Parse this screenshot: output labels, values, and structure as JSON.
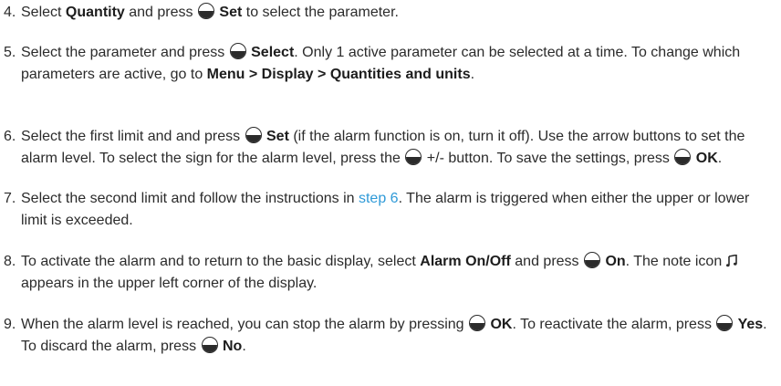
{
  "steps": [
    {
      "number": "4.",
      "parts": [
        {
          "t": "text",
          "v": "Select "
        },
        {
          "t": "bold",
          "v": "Quantity"
        },
        {
          "t": "text",
          "v": " and press "
        },
        {
          "t": "icon",
          "v": "softkey-button-icon"
        },
        {
          "t": "bold",
          "v": " Set"
        },
        {
          "t": "text",
          "v": " to select the parameter."
        }
      ]
    },
    {
      "number": "5.",
      "parts": [
        {
          "t": "text",
          "v": "Select the parameter and press "
        },
        {
          "t": "icon",
          "v": "softkey-button-icon"
        },
        {
          "t": "bold",
          "v": " Select"
        },
        {
          "t": "text",
          "v": ". Only 1 active parameter can be selected at a time. To change which parameters are active, go to "
        },
        {
          "t": "bold",
          "v": "Menu > Display > Quantities and units"
        },
        {
          "t": "text",
          "v": "."
        }
      ]
    },
    {
      "number": "6.",
      "parts": [
        {
          "t": "text",
          "v": "Select the first limit and and press "
        },
        {
          "t": "icon",
          "v": "softkey-button-icon"
        },
        {
          "t": "bold",
          "v": " Set"
        },
        {
          "t": "text",
          "v": " (if the alarm function is on, turn it off). Use the arrow buttons to set the alarm level. To select the sign for the alarm level, press the "
        },
        {
          "t": "icon",
          "v": "softkey-button-icon"
        },
        {
          "t": "text",
          "v": " +/- button. To save the settings, press "
        },
        {
          "t": "icon",
          "v": "softkey-button-icon"
        },
        {
          "t": "bold",
          "v": " OK"
        },
        {
          "t": "text",
          "v": "."
        }
      ]
    },
    {
      "number": "7.",
      "parts": [
        {
          "t": "text",
          "v": "Select the second limit and follow the instructions in "
        },
        {
          "t": "link",
          "v": "step 6"
        },
        {
          "t": "text",
          "v": ". The alarm is triggered when either the upper or lower limit is exceeded."
        }
      ]
    },
    {
      "number": "8.",
      "parts": [
        {
          "t": "text",
          "v": "To activate the alarm and to return to the basic display, select "
        },
        {
          "t": "bold",
          "v": "Alarm On/Off"
        },
        {
          "t": "text",
          "v": " and press "
        },
        {
          "t": "icon",
          "v": "softkey-button-icon"
        },
        {
          "t": "text",
          "v": " "
        },
        {
          "t": "bold",
          "v": "On"
        },
        {
          "t": "text",
          "v": ". The note icon "
        },
        {
          "t": "icon",
          "v": "music-note-icon"
        },
        {
          "t": "text",
          "v": " appears in the upper left corner of the display."
        }
      ]
    },
    {
      "number": "9.",
      "parts": [
        {
          "t": "text",
          "v": "When the alarm level is reached, you can stop the alarm by pressing "
        },
        {
          "t": "icon",
          "v": "softkey-button-icon"
        },
        {
          "t": "bold",
          "v": " OK"
        },
        {
          "t": "text",
          "v": ". To reactivate the alarm, press "
        },
        {
          "t": "icon",
          "v": "softkey-button-icon"
        },
        {
          "t": "bold",
          "v": " Yes"
        },
        {
          "t": "text",
          "v": ". To discard the alarm, press "
        },
        {
          "t": "icon",
          "v": "softkey-button-icon"
        },
        {
          "t": "bold",
          "v": " No"
        },
        {
          "t": "text",
          "v": "."
        }
      ]
    }
  ]
}
